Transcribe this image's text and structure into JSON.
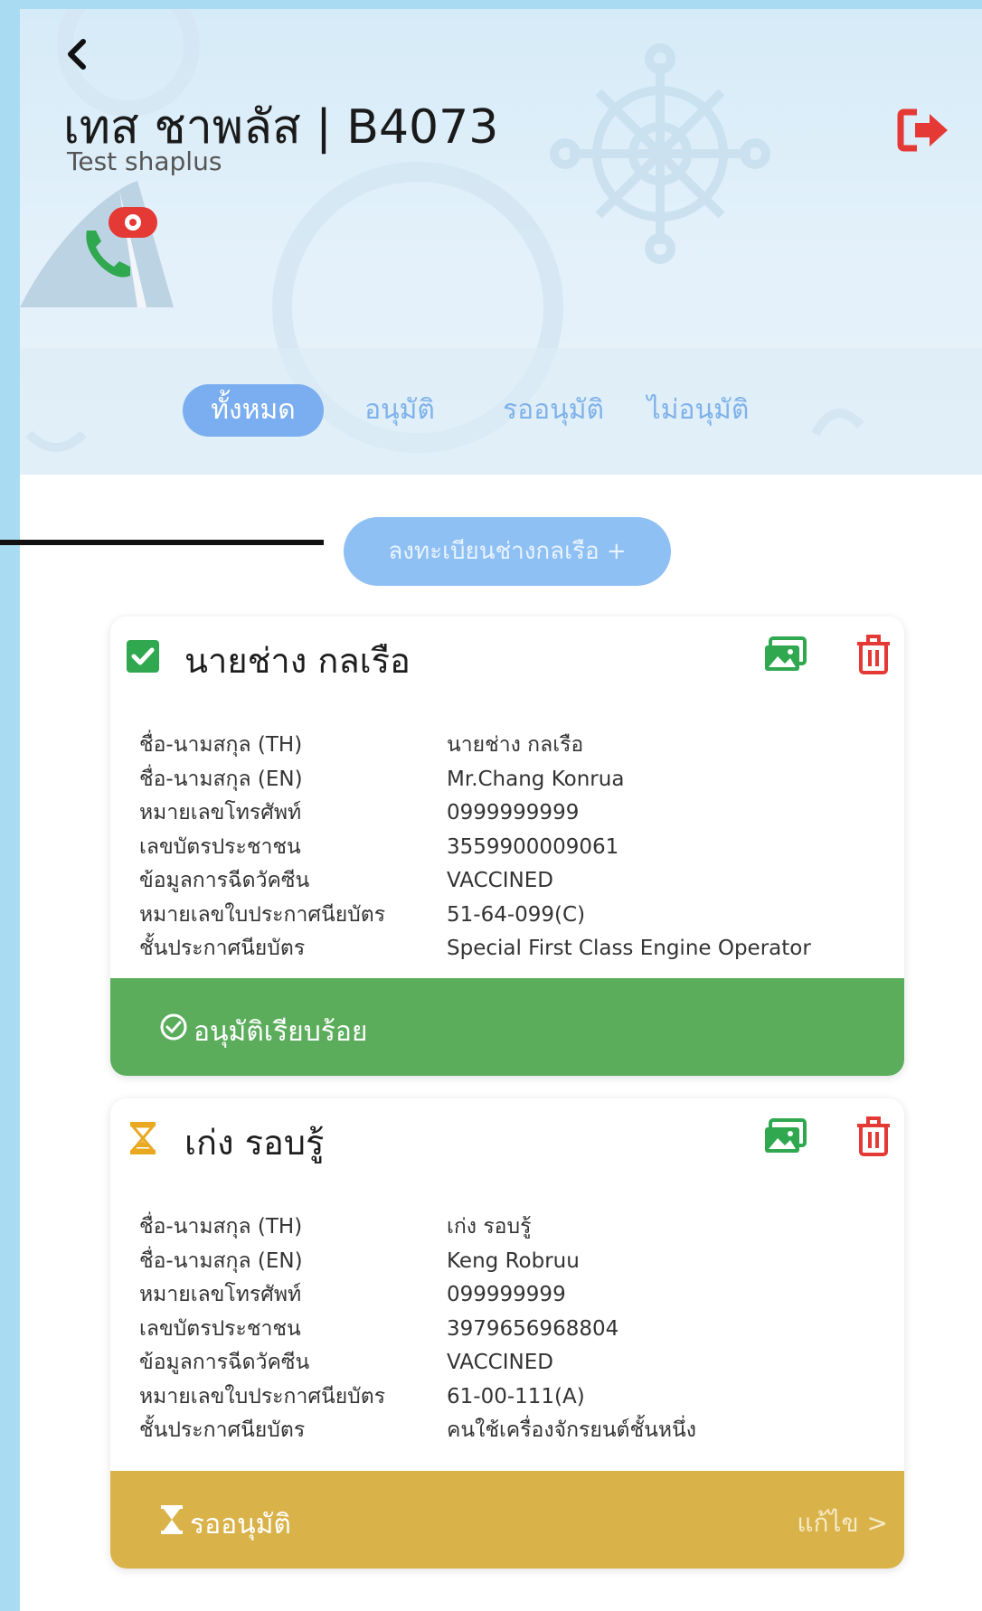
{
  "header": {
    "title": "เทส ชาพลัส | B4073",
    "subtitle": "Test shaplus"
  },
  "tabs": [
    {
      "label": "ทั้งหมด",
      "active": true
    },
    {
      "label": "อนุมัติ",
      "active": false
    },
    {
      "label": "รออนุมัติ",
      "active": false
    },
    {
      "label": "ไม่อนุมัติ",
      "active": false
    }
  ],
  "add_button_label": "ลงทะเบียนช่างกลเรือ +",
  "field_labels": [
    "ชื่อ-นามสกุล (TH)",
    "ชื่อ-นามสกุล (EN)",
    "หมายเลขโทรศัพท์",
    "เลขบัตรประชาชน",
    "ข้อมูลการฉีดวัคซีน",
    "หมายเลขใบประกาศนียบัตร",
    "ชั้นประกาศนียบัตร"
  ],
  "cards": [
    {
      "name": "นายช่าง กลเรือ",
      "status_icon": "check-icon",
      "values": [
        "นายช่าง กลเรือ",
        "Mr.Chang Konrua",
        "0999999999",
        "3559900009061",
        "VACCINED",
        "51-64-099(C)",
        "Special First Class Engine Operator"
      ],
      "status_text": "อนุมัติเรียบร้อย",
      "status_color": "#5bad5c"
    },
    {
      "name": "เก่ง รอบรู้",
      "status_icon": "hourglass-icon",
      "values": [
        "เก่ง รอบรู้",
        "Keng Robruu",
        "099999999",
        "3979656968804",
        "VACCINED",
        "61-00-111(A)",
        "คนใช้เครื่องจักรยนต์ชั้นหนึ่ง"
      ],
      "status_text": "รออนุมัติ",
      "status_color": "#d9b24a",
      "edit_label": "แก้ไข >"
    }
  ],
  "colors": {
    "accent": "#7aaef0",
    "approved": "#5bad5c",
    "pending": "#d9b24a",
    "danger": "#e53935"
  }
}
